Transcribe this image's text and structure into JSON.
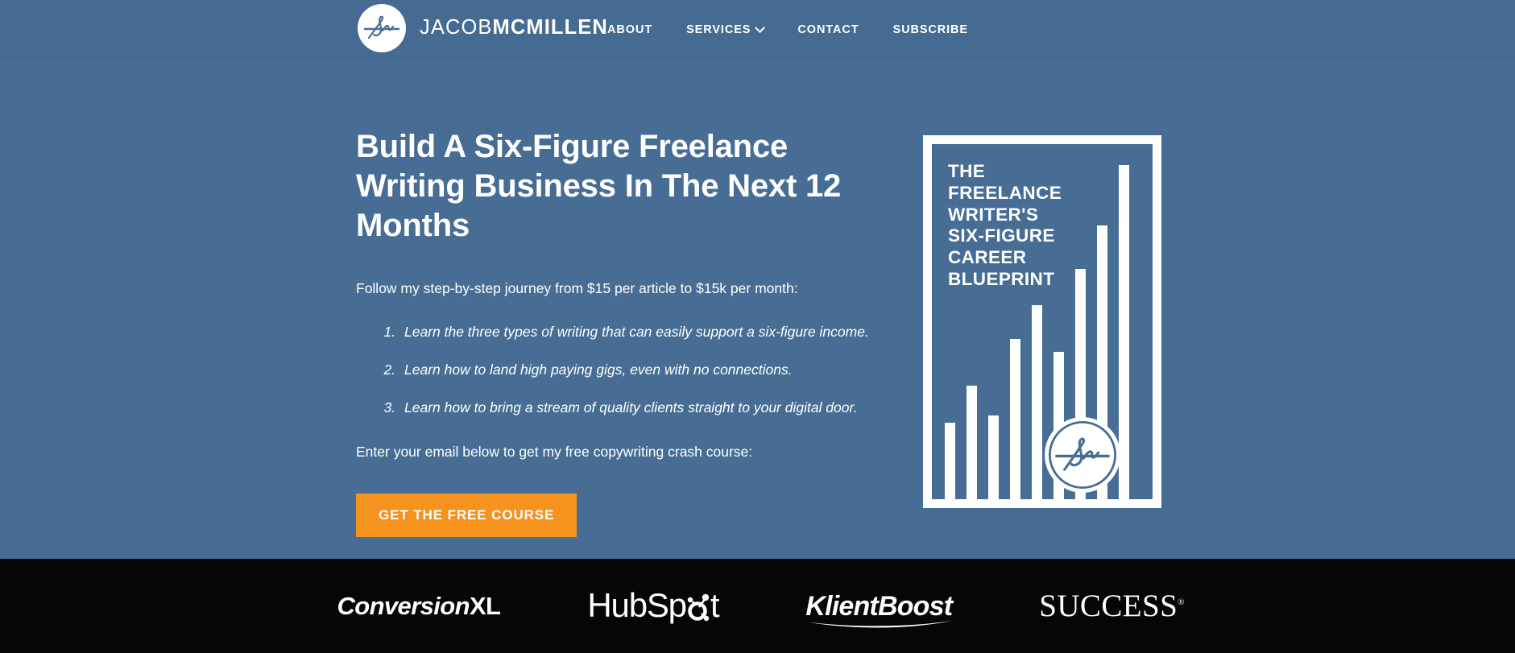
{
  "header": {
    "brand": {
      "light": "JACOB",
      "bold": "MCMILLEN",
      "mark_icon": "jm-monogram-icon"
    },
    "nav": [
      {
        "label": "ABOUT",
        "has_dropdown": false
      },
      {
        "label": "SERVICES",
        "has_dropdown": true,
        "icon": "chevron-down-icon"
      },
      {
        "label": "CONTACT",
        "has_dropdown": false
      },
      {
        "label": "SUBSCRIBE",
        "has_dropdown": false
      }
    ]
  },
  "hero": {
    "headline": "Build A Six-Figure Freelance Writing Business In The Next 12 Months",
    "lede": "Follow my step-by-step journey from $15 per article to $15k per month:",
    "benefits": [
      "Learn the three types of writing that can easily support a six-figure income.",
      "Learn how to land high paying gigs, even with no connections.",
      "Learn how to bring a stream of quality clients straight to your digital door."
    ],
    "cta_lede": "Enter your email below to get my free copywriting crash course:",
    "cta_button": "GET THE FREE COURSE"
  },
  "book_cover": {
    "title": "THE\nFREELANCE\nWRITER'S\nSIX-FIGURE\nCAREER\nBLUEPRINT",
    "badge_icon": "jm-monogram-icon",
    "chart_data": {
      "type": "bar",
      "title": "",
      "categories": [
        "1",
        "2",
        "3",
        "4",
        "5",
        "6",
        "7",
        "8",
        "9"
      ],
      "values": [
        23,
        34,
        25,
        48,
        58,
        44,
        69,
        82,
        100
      ],
      "xlabel": "",
      "ylabel": "",
      "ylim": [
        0,
        100
      ],
      "grid": false,
      "legend": "none",
      "bar_color": "#ffffff",
      "background": "#476d94"
    }
  },
  "logo_strip": {
    "logos": [
      {
        "name": "ConversionXL",
        "italic_part": "Conversion",
        "upright_part": "XL"
      },
      {
        "name": "HubSpot",
        "text": "HubSp",
        "tail": "t"
      },
      {
        "name": "KlientBoost",
        "text": "KlientBoost"
      },
      {
        "name": "SUCCESS",
        "text": "SUCCESS",
        "tm": "®"
      }
    ]
  },
  "colors": {
    "brand_blue": "#476d94",
    "header_blue": "#456b92",
    "accent_orange": "#f6921e",
    "strip_black": "#070606",
    "white": "#ffffff"
  }
}
